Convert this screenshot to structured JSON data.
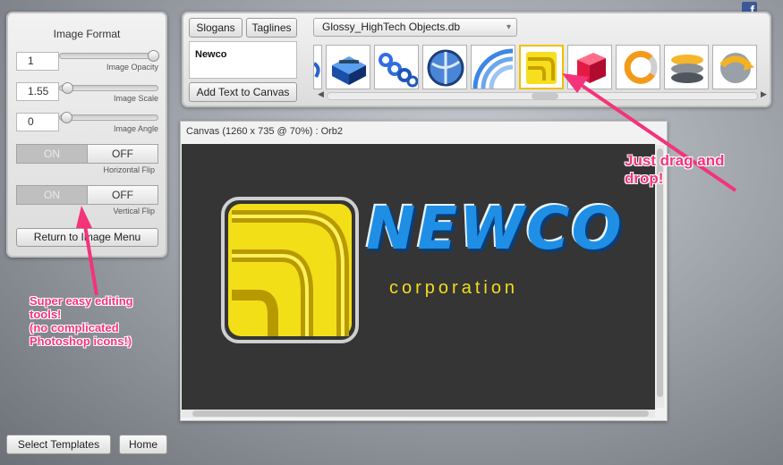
{
  "left_panel": {
    "title": "Image Format",
    "opacity": {
      "value": "1",
      "caption": "Image Opacity"
    },
    "scale": {
      "value": "1.55",
      "caption": "Image Scale"
    },
    "angle": {
      "value": "0",
      "caption": "Image Angle"
    },
    "horizontal_flip": {
      "on": "ON",
      "off": "OFF",
      "caption": "Horizontal Flip"
    },
    "vertical_flip": {
      "on": "ON",
      "off": "OFF",
      "caption": "Vertical Flip"
    },
    "return_button": "Return to Image Menu"
  },
  "top_panel": {
    "slogans_button": "Slogans",
    "taglines_button": "Taglines",
    "text_value": "Newco",
    "add_text_button": "Add Text to Canvas",
    "library_select": "Glossy_HighTech Objects.db",
    "thumbnails": [
      "swirl-icon",
      "stacked-cube-icon",
      "chain-rings-icon",
      "globe-orb-icon",
      "fan-arcs-icon",
      "rss-orb-icon",
      "red-cube-icon",
      "ring-arc-icon",
      "layered-disks-icon",
      "arrow-sphere-icon"
    ]
  },
  "canvas": {
    "title": "Canvas (1260 x 735 @ 70%) : Orb2",
    "logo_text": "NEWCO",
    "logo_subtext": "corporation"
  },
  "bottom_buttons": {
    "select_templates": "Select Templates",
    "home": "Home"
  },
  "annotations": {
    "drag_drop": "Just drag and drop!",
    "editing": [
      "Super easy editing",
      "tools!",
      "(no complicated",
      "Photoshop icons!)"
    ]
  },
  "facebook_icon": "facebook-icon",
  "colors": {
    "annotation": "#f4337a",
    "canvas_bg": "#353535",
    "logo_blue": "#1f8fe6",
    "logo_yellow": "#f2de1c",
    "facebook": "#3b5998"
  }
}
